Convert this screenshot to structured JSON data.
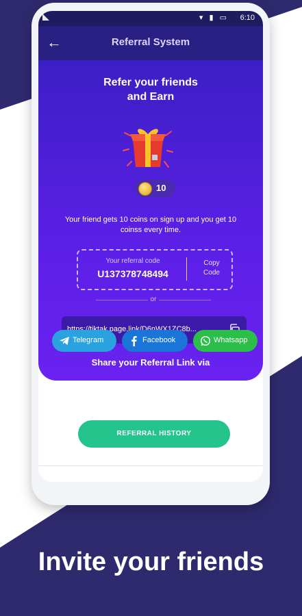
{
  "status_bar": {
    "time": "6:10",
    "icons": "▾ ▮ ▭"
  },
  "app_bar": {
    "title": "Referral System"
  },
  "hero": {
    "headline_line1": "Refer your friends",
    "headline_line2": "and Earn",
    "coins": "10",
    "description": "Your friend gets 10 coins on sign up and you get 10 coinss every time.",
    "code_label": "Your referral code",
    "code_value": "U137378748494",
    "copy_code_label_1": "Copy",
    "copy_code_label_2": "Code",
    "or_text": "or",
    "referral_link": "https://tiktak.page.link/D6nWX1ZC8b...",
    "share_title": "Share your Referral Link via"
  },
  "share_buttons": {
    "telegram": "Telegram",
    "facebook": "Facebook",
    "whatsapp": "Whatsapp"
  },
  "history_button": "REFERRAL HISTORY",
  "caption": "Invite your friends",
  "colors": {
    "background_dark": "#2f2a6e",
    "app_bar": "#2a1f83",
    "hero_gradient": "#3b1fc4",
    "history_button": "#24c48c",
    "telegram": "#2aa2e0",
    "facebook": "#1b75d8",
    "whatsapp": "#2bbf4a"
  }
}
